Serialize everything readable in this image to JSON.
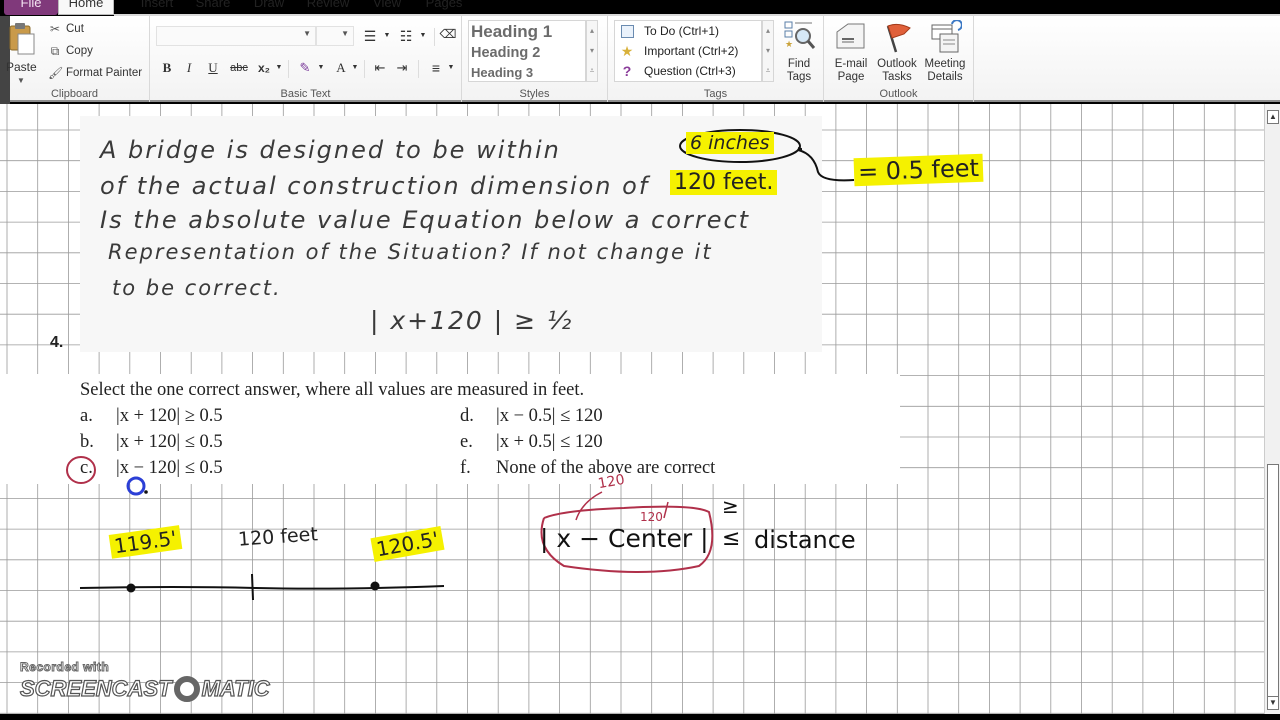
{
  "app": {
    "tabs": [
      {
        "label": "File"
      },
      {
        "label": "Home"
      },
      {
        "label": "Insert"
      },
      {
        "label": "Share"
      },
      {
        "label": "Draw"
      },
      {
        "label": "Review"
      },
      {
        "label": "View"
      },
      {
        "label": "Pages"
      }
    ],
    "active_tab": "Home"
  },
  "ribbon": {
    "clipboard": {
      "label": "Clipboard",
      "paste": "Paste",
      "cut": "Cut",
      "copy": "Copy",
      "format_painter": "Format Painter"
    },
    "basic_text": {
      "label": "Basic Text",
      "font_name": "",
      "font_size": "",
      "bold": "B",
      "italic": "I",
      "underline": "U",
      "strikethrough": "abc",
      "subscript": "x₂",
      "font_color": "A"
    },
    "styles": {
      "label": "Styles",
      "items": [
        {
          "label": "Heading 1"
        },
        {
          "label": "Heading 2"
        },
        {
          "label": "Heading 3"
        }
      ]
    },
    "tags": {
      "label": "Tags",
      "items": [
        {
          "label": "To Do (Ctrl+1)",
          "icon": "checkbox-icon"
        },
        {
          "label": "Important (Ctrl+2)",
          "icon": "star-icon"
        },
        {
          "label": "Question (Ctrl+3)",
          "icon": "question-icon"
        }
      ],
      "find_tags": "Find Tags"
    },
    "outlook": {
      "label": "Outlook",
      "email_page": "E-mail Page",
      "outlook_tasks": "Outlook Tasks",
      "meeting_details": "Meeting Details"
    }
  },
  "page": {
    "question_number": "4.",
    "scan": {
      "lines": [
        "A bridge is designed to be within",
        "of the actual construction dimension of",
        "Is the absolute value Equation below a correct",
        "Representation of the Situation? If not change it",
        "to be correct."
      ],
      "highlight_1": "6 inches",
      "highlight_2": "120 feet.",
      "equation": "| x+120 | ≥ ½"
    },
    "annotation_conversion": "= 0.5 feet",
    "choices": {
      "prompt": "Select the one correct answer, where all values are measured in feet.",
      "items": [
        {
          "letter": "a.",
          "expr": "|x + 120| ≥ 0.5"
        },
        {
          "letter": "b.",
          "expr": "|x + 120| ≤ 0.5"
        },
        {
          "letter": "c.",
          "expr": "|x − 120| ≤ 0.5"
        },
        {
          "letter": "d.",
          "expr": "|x − 0.5| ≤ 120"
        },
        {
          "letter": "e.",
          "expr": "|x + 0.5| ≤ 120"
        },
        {
          "letter": "f.",
          "expr": "None of the above are correct"
        }
      ],
      "selected": "c."
    },
    "number_line": {
      "left_label": "119.5'",
      "center_label": "120 feet",
      "right_label": "120.5'"
    },
    "formula": {
      "abs_expr": "| x − Center |",
      "ge": "≥",
      "le": "≤",
      "rhs": "distance",
      "note_x": "120",
      "note_center": "120"
    }
  },
  "watermark": {
    "line1": "Recorded with",
    "line2a": "SCREENCAST",
    "line2b": "MATIC"
  },
  "colors": {
    "highlight": "#f5f100",
    "file_tab": "#80397b",
    "red_ink": "#b0304a",
    "blue_ink": "#2b3fd6"
  }
}
